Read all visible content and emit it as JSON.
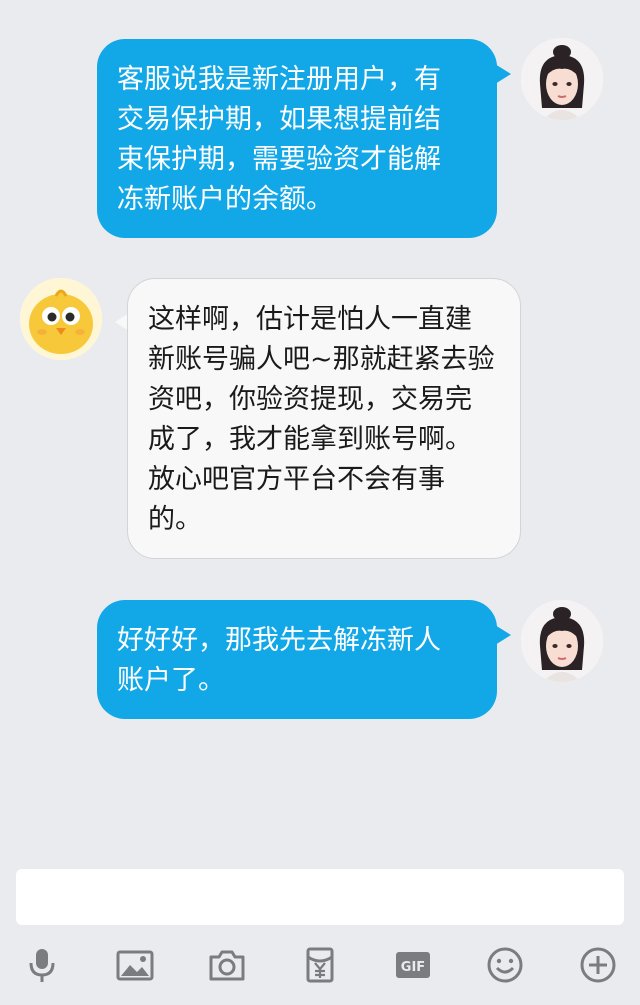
{
  "conversation": {
    "messages": [
      {
        "sender": "self",
        "text": "客服说我是新注册用户，有\n交易保护期，如果想提前结\n束保护期，需要验资才能解\n冻新账户的余额。"
      },
      {
        "sender": "other",
        "text": "这样啊，估计是怕人一直建\n新账号骗人吧~那就赶紧去验\n资吧，你验资提现，交易完\n成了，我才能拿到账号啊。\n放心吧官方平台不会有事\n的。"
      },
      {
        "sender": "self",
        "text": "好好好，那我先去解冻新人\n账户了。"
      }
    ]
  },
  "composer": {
    "input_value": "",
    "toolbar_icons": [
      "microphone-icon",
      "image-icon",
      "camera-icon",
      "red-packet-icon",
      "gif-icon",
      "emoji-icon",
      "plus-icon"
    ]
  },
  "colors": {
    "background": "#eaebef",
    "outgoing_bubble": "#12a8e8",
    "incoming_bubble": "#f8f8f8",
    "icon": "#7a7c80"
  }
}
